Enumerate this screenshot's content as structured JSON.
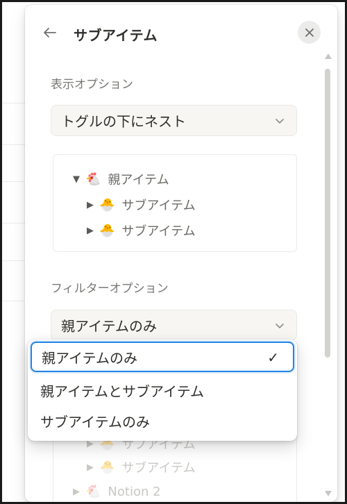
{
  "header": {
    "title": "サブアイテム",
    "back_icon": "arrow-left-icon",
    "close_icon": "close-icon"
  },
  "display_options": {
    "label": "表示オプション",
    "selected": "トグルの下にネスト"
  },
  "preview": {
    "parent": {
      "emoji": "🐔",
      "label": "親アイテム"
    },
    "children": [
      {
        "emoji": "🐣",
        "label": "サブアイテム"
      },
      {
        "emoji": "🐣",
        "label": "サブアイテム"
      }
    ]
  },
  "filter_options": {
    "label": "フィルターオプション",
    "selected": "親アイテムのみ"
  },
  "dropdown": {
    "items": [
      {
        "label": "親アイテムのみ",
        "selected": true
      },
      {
        "label": "親アイテムとサブアイテム",
        "selected": false
      },
      {
        "label": "サブアイテムのみ",
        "selected": false
      }
    ],
    "check_mark": "✓"
  },
  "lower_preview": {
    "rows": [
      {
        "emoji": "🐣",
        "label": "サブアイテム"
      },
      {
        "emoji": "🐣",
        "label": "サブアイテム"
      },
      {
        "emoji": "🐔",
        "label": "Notion 2"
      }
    ]
  },
  "colors": {
    "accent": "#2383e2",
    "text": "#2f2e2b",
    "muted": "#787774"
  }
}
